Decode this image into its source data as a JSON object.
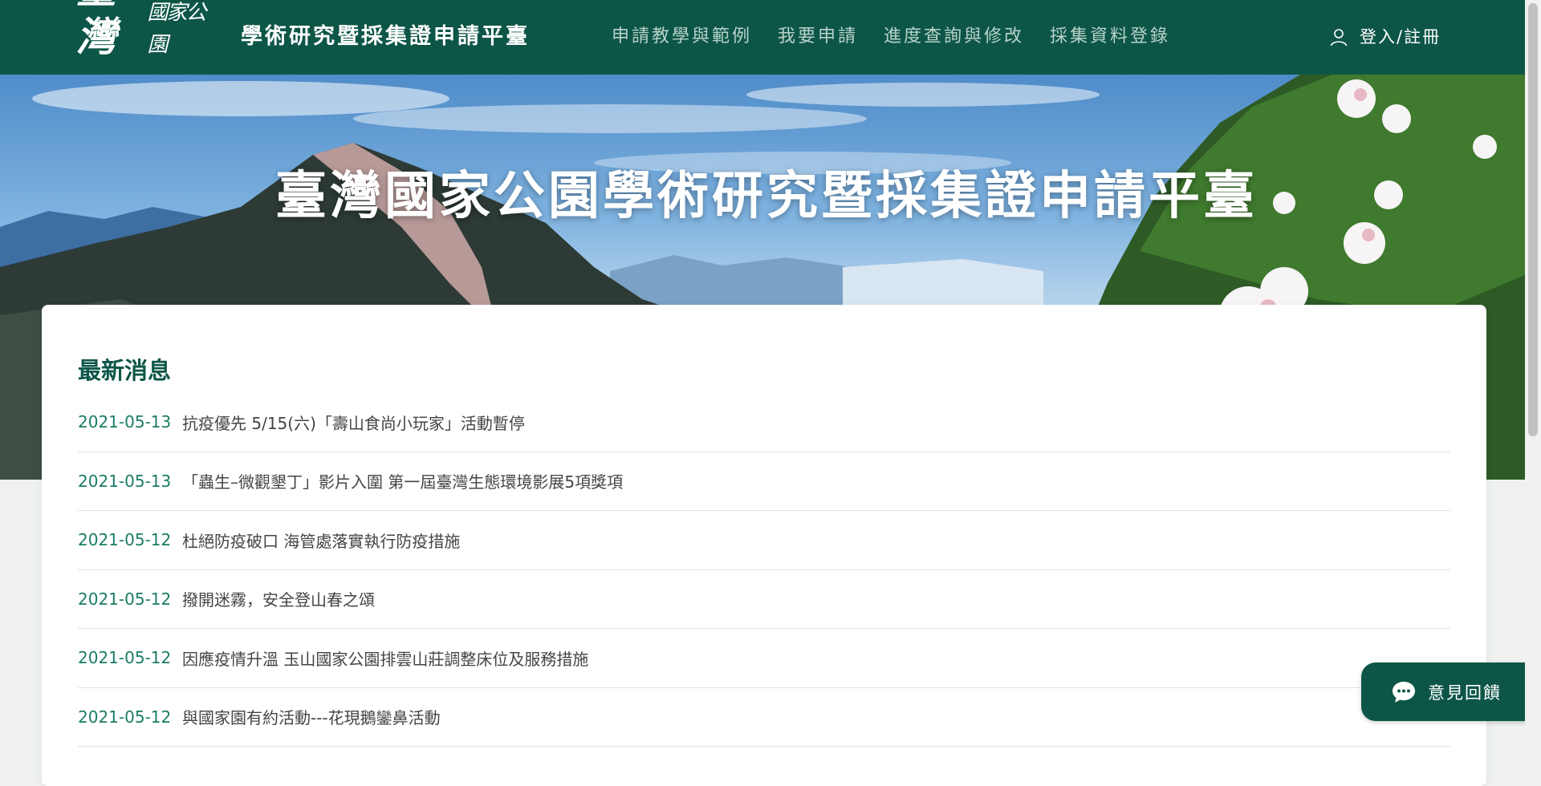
{
  "header": {
    "logo_text_big": "臺灣",
    "logo_text_small": "國家公園",
    "site_title": "學術研究暨採集證申請平臺",
    "nav_items": [
      {
        "label": "申請教學與範例"
      },
      {
        "label": "我要申請"
      },
      {
        "label": "進度查詢與修改"
      },
      {
        "label": "採集資料登錄"
      }
    ],
    "login_label": "登入/註冊",
    "login_icon": "user-icon"
  },
  "hero": {
    "title": "臺灣國家公園學術研究暨採集證申請平臺"
  },
  "news": {
    "heading": "最新消息",
    "items": [
      {
        "date": "2021-05-13",
        "title": "抗疫優先 5/15(六)「壽山食尚小玩家」活動暫停"
      },
      {
        "date": "2021-05-13",
        "title": "「蟲生–微觀墾丁」影片入圍 第一屆臺灣生態環境影展5項獎項"
      },
      {
        "date": "2021-05-12",
        "title": "杜絕防疫破口 海管處落實執行防疫措施"
      },
      {
        "date": "2021-05-12",
        "title": "撥開迷霧，安全登山春之頌"
      },
      {
        "date": "2021-05-12",
        "title": "因應疫情升溫 玉山國家公園排雲山莊調整床位及服務措施"
      },
      {
        "date": "2021-05-12",
        "title": "與國家園有約活動---花現鵝鑾鼻活動"
      }
    ]
  },
  "feedback": {
    "label": "意見回饋",
    "icon": "chat-bubble-icon"
  },
  "colors": {
    "brand": "#0d5647",
    "nav_text": "#b7d2c9",
    "date_text": "#1a7c66",
    "page_bg": "#eef1f0"
  }
}
